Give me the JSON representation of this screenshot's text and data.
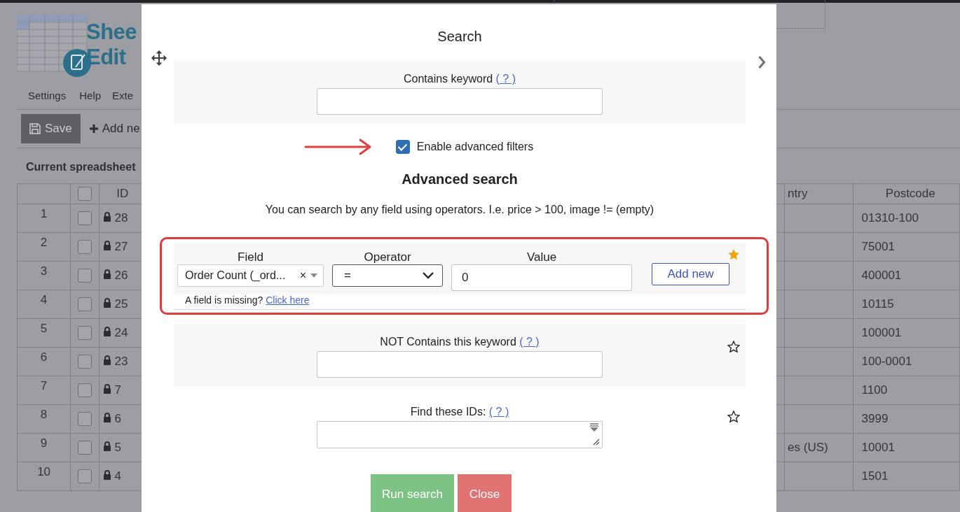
{
  "background": {
    "logo": {
      "line_1": "Shee",
      "line_2": "Edit"
    },
    "menu": [
      "Settings",
      "Help",
      "Exte"
    ],
    "toolbar": {
      "save": "Save",
      "add": "Add ne"
    },
    "heading": "Current spreadsheet",
    "table": {
      "header_checked": false,
      "columns": [
        "",
        "ID",
        "ntry",
        "Postcode"
      ],
      "rows": [
        {
          "number": "1",
          "checked": false,
          "id": "28",
          "country": "",
          "postcode": "01310-100"
        },
        {
          "number": "2",
          "checked": false,
          "id": "27",
          "country": "",
          "postcode": "75001"
        },
        {
          "number": "3",
          "checked": false,
          "id": "26",
          "country": "",
          "postcode": "400001"
        },
        {
          "number": "4",
          "checked": false,
          "id": "25",
          "country": "",
          "postcode": "10115"
        },
        {
          "number": "5",
          "checked": false,
          "id": "24",
          "country": "",
          "postcode": "100001"
        },
        {
          "number": "6",
          "checked": false,
          "id": "23",
          "country": "",
          "postcode": "100-0001"
        },
        {
          "number": "7",
          "checked": false,
          "id": "7",
          "country": "",
          "postcode": "1100"
        },
        {
          "number": "8",
          "checked": false,
          "id": "6",
          "country": "",
          "postcode": "3999"
        },
        {
          "number": "9",
          "checked": false,
          "id": "5",
          "country": "es (US)",
          "postcode": "10001"
        },
        {
          "number": "10",
          "checked": false,
          "id": "4",
          "country": "",
          "postcode": "1501"
        }
      ]
    }
  },
  "modal": {
    "title": "Search",
    "keyword": {
      "label": "Contains keyword",
      "help": "( ? )"
    },
    "advanced_toggle": {
      "checked": true,
      "label": "Enable advanced filters"
    },
    "advanced_heading": "Advanced search",
    "advanced_hint": "You can search by any field using operators. I.e. price > 100, image != (empty)",
    "filter": {
      "starred": true,
      "field_label": "Field",
      "field_value": "Order Count (_ord...",
      "clear": "×",
      "operator_label": "Operator",
      "operator_value": "=",
      "value_label": "Value",
      "value": "0",
      "add_button": "Add new",
      "missing_text": "A field is missing?",
      "missing_link": "Click here"
    },
    "not_keyword": {
      "starred": false,
      "label": "NOT Contains this keyword",
      "help": "( ? )"
    },
    "ids": {
      "starred": false,
      "label": "Find these IDs:",
      "help": "( ? )"
    },
    "buttons": [
      {
        "label": "Run search",
        "kind": "primary"
      },
      {
        "label": "Close",
        "kind": "danger"
      }
    ]
  }
}
